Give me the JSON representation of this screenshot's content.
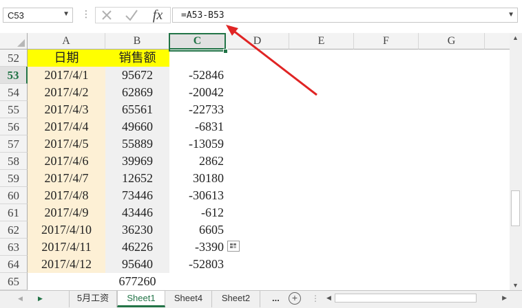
{
  "name_box": "C53",
  "formula": "=A53-B53",
  "formula_icons": [
    "cancel-icon",
    "enter-icon",
    "function-icon"
  ],
  "columns": [
    "A",
    "B",
    "C",
    "D",
    "E",
    "F",
    "G"
  ],
  "selected_column": "C",
  "selected_row": "53",
  "header_row": {
    "row": "52",
    "a": "日期",
    "b": "销售额"
  },
  "rows": [
    {
      "row": "53",
      "a": "2017/4/1",
      "b": "95672",
      "c": "-52846"
    },
    {
      "row": "54",
      "a": "2017/4/2",
      "b": "62869",
      "c": "-20042"
    },
    {
      "row": "55",
      "a": "2017/4/3",
      "b": "65561",
      "c": "-22733"
    },
    {
      "row": "56",
      "a": "2017/4/4",
      "b": "49660",
      "c": "-6831"
    },
    {
      "row": "57",
      "a": "2017/4/5",
      "b": "55889",
      "c": "-13059"
    },
    {
      "row": "58",
      "a": "2017/4/6",
      "b": "39969",
      "c": "2862"
    },
    {
      "row": "59",
      "a": "2017/4/7",
      "b": "12652",
      "c": "30180"
    },
    {
      "row": "60",
      "a": "2017/4/8",
      "b": "73446",
      "c": "-30613"
    },
    {
      "row": "61",
      "a": "2017/4/9",
      "b": "43446",
      "c": "-612"
    },
    {
      "row": "62",
      "a": "2017/4/10",
      "b": "36230",
      "c": "6605"
    },
    {
      "row": "63",
      "a": "2017/4/11",
      "b": "46226",
      "c": "-3390"
    },
    {
      "row": "64",
      "a": "2017/4/12",
      "b": "95640",
      "c": "-52803"
    }
  ],
  "total_row": {
    "row": "65",
    "b": "677260"
  },
  "sheet_tabs": [
    {
      "label": "5月工资",
      "active": false
    },
    {
      "label": "Sheet1",
      "active": true
    },
    {
      "label": "Sheet4",
      "active": false
    },
    {
      "label": "Sheet2",
      "active": false
    }
  ],
  "more_tabs": "...",
  "colors": {
    "accent": "#217346",
    "header_fill": "#ffff00",
    "date_fill": "#fdf0d5",
    "arrow": "#e02424"
  }
}
